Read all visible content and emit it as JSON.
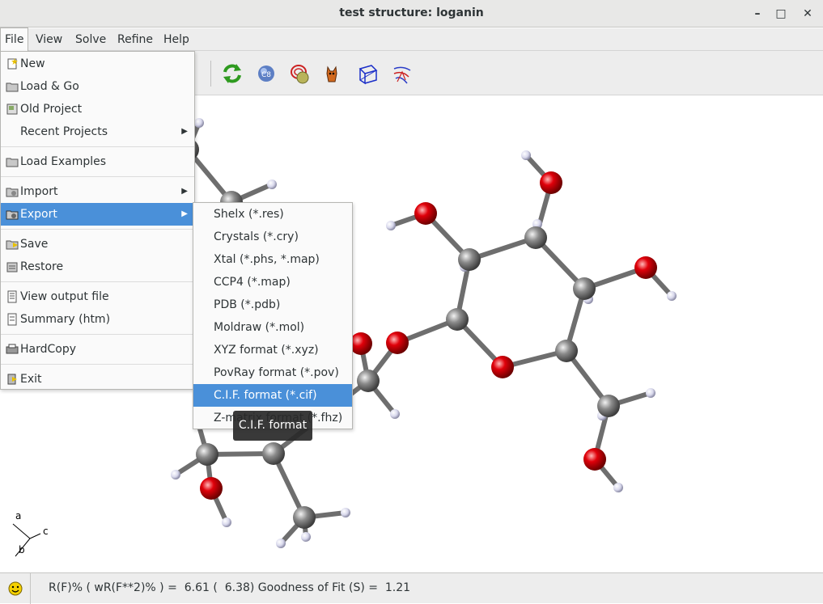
{
  "window": {
    "title": "test structure: loganin",
    "minimize_label": "–",
    "maximize_label": "□",
    "close_label": "✕"
  },
  "menubar": {
    "items": [
      {
        "label": "File"
      },
      {
        "label": "View"
      },
      {
        "label": "Solve"
      },
      {
        "label": "Refine"
      },
      {
        "label": "Help"
      }
    ]
  },
  "toolbar": {
    "icons": [
      "refresh-icon",
      "c8-icon",
      "contour-icon",
      "cat-icon",
      "unit-cell-icon",
      "fourier-map-icon"
    ]
  },
  "file_menu": {
    "items": [
      {
        "label": "New",
        "icon": "new-icon",
        "submenu": false
      },
      {
        "label": "Load & Go",
        "icon": "load-go-icon",
        "submenu": false
      },
      {
        "label": "Old Project",
        "icon": "old-project-icon",
        "submenu": false
      },
      {
        "label": "Recent Projects",
        "icon": "",
        "submenu": true
      },
      {
        "label": "Load Examples",
        "icon": "load-examples-icon",
        "submenu": false
      },
      {
        "label": "Import",
        "icon": "import-icon",
        "submenu": true
      },
      {
        "label": "Export",
        "icon": "export-icon",
        "submenu": true,
        "highlighted": true
      },
      {
        "label": "Save",
        "icon": "save-icon",
        "submenu": false
      },
      {
        "label": "Restore",
        "icon": "restore-icon",
        "submenu": false
      },
      {
        "label": "View output file",
        "icon": "output-file-icon",
        "submenu": false
      },
      {
        "label": "Summary (htm)",
        "icon": "summary-icon",
        "submenu": false
      },
      {
        "label": "HardCopy",
        "icon": "hardcopy-icon",
        "submenu": false
      },
      {
        "label": "Exit",
        "icon": "exit-icon",
        "submenu": false
      }
    ],
    "submenu_arrow": "▶"
  },
  "export_submenu": {
    "items": [
      {
        "label": "Shelx (*.res)"
      },
      {
        "label": "Crystals (*.cry)"
      },
      {
        "label": "Xtal (*.phs, *.map)"
      },
      {
        "label": "CCP4 (*.map)"
      },
      {
        "label": "PDB (*.pdb)"
      },
      {
        "label": "Moldraw (*.mol)"
      },
      {
        "label": "XYZ format (*.xyz)"
      },
      {
        "label": "PovRay format (*.pov)"
      },
      {
        "label": "C.I.F. format (*.cif)",
        "highlighted": true
      },
      {
        "label": "Z-matrix format (*.fhz)"
      }
    ]
  },
  "tooltip": {
    "text": "C.I.F. format"
  },
  "axes": {
    "a": "a",
    "b": "b",
    "c": "c"
  },
  "statusbar": {
    "text": "R(F)% ( wR(F**2)% ) =  6.61 (  6.38) Goodness of Fit (S) =  1.21",
    "icon": "smiley-icon"
  },
  "colors": {
    "highlight": "#4a90d9",
    "oxygen": "#e0000a",
    "carbon": "#7a7a7a",
    "hydrogen": "#d8d8ec"
  }
}
